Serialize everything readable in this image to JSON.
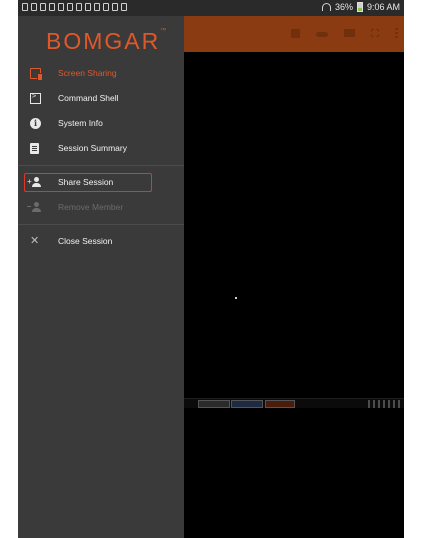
{
  "status_bar": {
    "battery_percent": "36%",
    "time": "9:06 AM",
    "notification_icons": [
      "usb-icon",
      "gallery-icon",
      "check-icon",
      "check-icon",
      "check-icon",
      "sync-icon",
      "shield-icon",
      "cloud-icon",
      "cloud-icon",
      "settings-icon",
      "keyboard-icon",
      "app-icon"
    ]
  },
  "brand": {
    "name": "BOMGAR",
    "mark": "™"
  },
  "menu": {
    "items": [
      {
        "label": "Screen Sharing",
        "icon": "screen-sharing-icon",
        "state": "active"
      },
      {
        "label": "Command Shell",
        "icon": "terminal-icon",
        "state": "normal"
      },
      {
        "label": "System Info",
        "icon": "info-icon",
        "state": "normal"
      },
      {
        "label": "Session Summary",
        "icon": "clipboard-icon",
        "state": "normal"
      }
    ],
    "session_items": [
      {
        "label": "Share Session",
        "icon": "add-person-icon",
        "state": "highlighted"
      },
      {
        "label": "Remove Member",
        "icon": "remove-person-icon",
        "state": "disabled"
      }
    ],
    "close_item": {
      "label": "Close Session",
      "icon": "close-icon"
    }
  },
  "app_bar": {
    "actions": [
      "stop-icon",
      "key-icon",
      "keyboard-icon",
      "fullscreen-icon",
      "more-vert-icon"
    ]
  },
  "colors": {
    "accent": "#e0582a",
    "app_bar": "#8a3b12",
    "drawer": "#3a3a3a",
    "highlight": "#e0362a"
  }
}
